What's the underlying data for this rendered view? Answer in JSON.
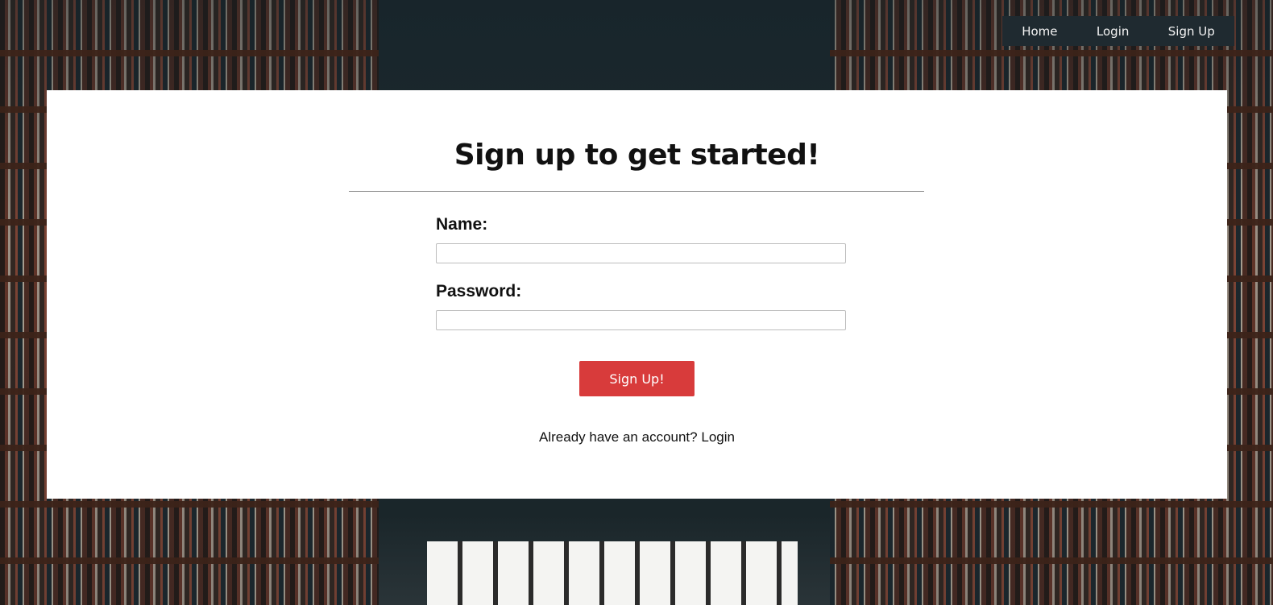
{
  "nav": {
    "items": [
      {
        "label": "Home"
      },
      {
        "label": "Login"
      },
      {
        "label": "Sign Up"
      }
    ]
  },
  "form": {
    "title": "Sign up to get started!",
    "name_label": "Name:",
    "name_value": "",
    "password_label": "Password:",
    "password_value": "",
    "submit_label": "Sign Up!",
    "login_prompt": "Already have an account?",
    "login_link": "Login"
  },
  "colors": {
    "accent": "#d83b3b",
    "nav_background": "#1f2a30"
  }
}
